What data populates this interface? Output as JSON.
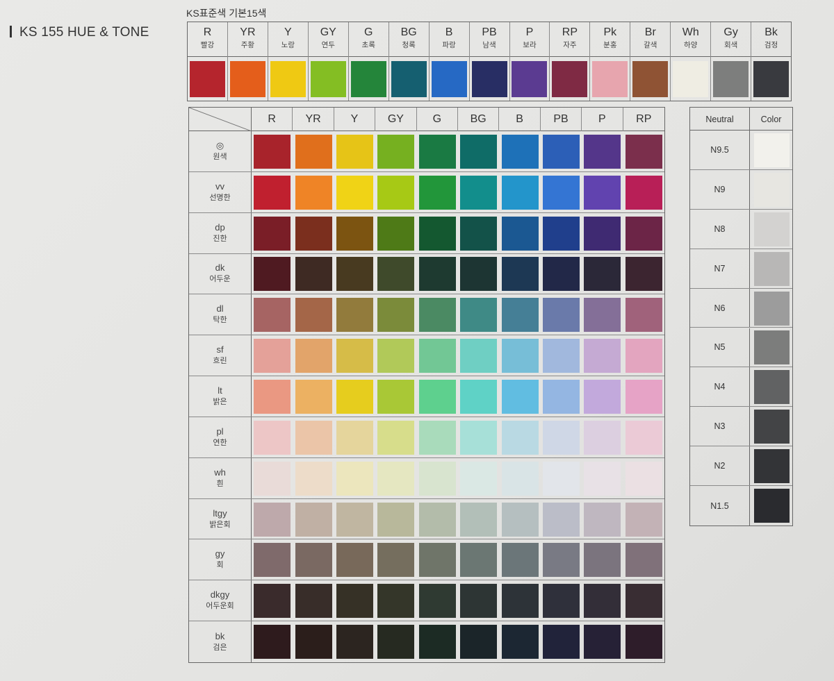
{
  "title": "KS 155 HUE & TONE",
  "basic_label": "KS표준색 기본15색",
  "basic": [
    {
      "code": "R",
      "name": "빨강",
      "color": "#b5252d"
    },
    {
      "code": "YR",
      "name": "주황",
      "color": "#e45e1b"
    },
    {
      "code": "Y",
      "name": "노랑",
      "color": "#efc913"
    },
    {
      "code": "GY",
      "name": "연두",
      "color": "#84be23"
    },
    {
      "code": "G",
      "name": "초록",
      "color": "#24853a"
    },
    {
      "code": "BG",
      "name": "청록",
      "color": "#155f70"
    },
    {
      "code": "B",
      "name": "파랑",
      "color": "#2669c4"
    },
    {
      "code": "PB",
      "name": "남색",
      "color": "#282e64"
    },
    {
      "code": "P",
      "name": "보라",
      "color": "#5b3b91"
    },
    {
      "code": "RP",
      "name": "자주",
      "color": "#7f2a44"
    },
    {
      "code": "Pk",
      "name": "분홍",
      "color": "#e7a5ae"
    },
    {
      "code": "Br",
      "name": "갈색",
      "color": "#8f5334"
    },
    {
      "code": "Wh",
      "name": "하양",
      "color": "#efede3"
    },
    {
      "code": "Gy",
      "name": "회색",
      "color": "#7d7e7d"
    },
    {
      "code": "Bk",
      "name": "검정",
      "color": "#393a3f"
    }
  ],
  "hues": [
    "R",
    "YR",
    "Y",
    "GY",
    "G",
    "BG",
    "B",
    "PB",
    "P",
    "RP"
  ],
  "tones": [
    {
      "code": "◎",
      "name": "원색",
      "colors": [
        "#a8232b",
        "#e06f1c",
        "#e6c417",
        "#76b020",
        "#1a7a43",
        "#0f6c67",
        "#1e71b8",
        "#2c5fb7",
        "#54368a",
        "#7b2f4c"
      ]
    },
    {
      "code": "vv",
      "name": "선명한",
      "colors": [
        "#c0202f",
        "#ef8426",
        "#f0d316",
        "#a7c915",
        "#22963a",
        "#128e8c",
        "#2395cb",
        "#3475d3",
        "#6143af",
        "#b81f57"
      ]
    },
    {
      "code": "dp",
      "name": "진한",
      "colors": [
        "#7a1e27",
        "#7b2f1e",
        "#7c5411",
        "#4e7a17",
        "#145830",
        "#135249",
        "#1b5892",
        "#203f8c",
        "#3f2a72",
        "#6c2547"
      ]
    },
    {
      "code": "dk",
      "name": "어두운",
      "colors": [
        "#4f1a21",
        "#3e2a23",
        "#483a20",
        "#3f4a2b",
        "#1e3a30",
        "#1d3533",
        "#1d3854",
        "#222848",
        "#2b2838",
        "#3c2530"
      ]
    },
    {
      "code": "dl",
      "name": "탁한",
      "colors": [
        "#a66463",
        "#a46648",
        "#927b3c",
        "#7b8b3a",
        "#4b8a63",
        "#3f8a86",
        "#457f96",
        "#6a7aaa",
        "#846f98",
        "#a0627b"
      ]
    },
    {
      "code": "sf",
      "name": "흐린",
      "colors": [
        "#e4a199",
        "#e2a46a",
        "#d6bc48",
        "#b1c959",
        "#72c795",
        "#6fcfc3",
        "#77bed7",
        "#a1b8dd",
        "#c5aad3",
        "#e3a5bf"
      ]
    },
    {
      "code": "lt",
      "name": "밝은",
      "colors": [
        "#ea9882",
        "#ecb162",
        "#e6cd1e",
        "#a9c836",
        "#5ed08e",
        "#5fd2c6",
        "#61bde1",
        "#94b6e2",
        "#c2a9dc",
        "#e6a3c6"
      ]
    },
    {
      "code": "pl",
      "name": "연한",
      "colors": [
        "#edc6c6",
        "#ebc5a8",
        "#e5d59c",
        "#d7dd8b",
        "#a9dbbb",
        "#a7e0d8",
        "#b9d9e3",
        "#cfd7e6",
        "#dccfe0",
        "#ebcad6"
      ]
    },
    {
      "code": "wh",
      "name": "흰",
      "colors": [
        "#e9dbd8",
        "#eddcc9",
        "#ece6bd",
        "#e5e7c1",
        "#d8e4cf",
        "#dae8e4",
        "#d9e4e6",
        "#e2e5ea",
        "#e8e1e6",
        "#ebe0e3"
      ]
    },
    {
      "code": "ltgy",
      "name": "밝은회",
      "colors": [
        "#bea9ab",
        "#c0b0a4",
        "#c0b6a1",
        "#b8b89b",
        "#b3bcaa",
        "#b2bfb8",
        "#b5bfc0",
        "#bbbdc8",
        "#bfb7c0",
        "#c3b2b6"
      ]
    },
    {
      "code": "gy",
      "name": "회",
      "colors": [
        "#7f6a6b",
        "#7a6962",
        "#78695a",
        "#756e5e",
        "#6f7569",
        "#6b7773",
        "#6b7679",
        "#797a84",
        "#7b747e",
        "#80717a"
      ]
    },
    {
      "code": "dkgy",
      "name": "어두운회",
      "colors": [
        "#3a2b2c",
        "#382d29",
        "#363126",
        "#343629",
        "#2f3a32",
        "#2d3534",
        "#2d3338",
        "#2f303b",
        "#332e38",
        "#392d33"
      ]
    },
    {
      "code": "bk",
      "name": "검은",
      "colors": [
        "#2e1b1d",
        "#2b1e1b",
        "#2c2520",
        "#262a21",
        "#1c2b24",
        "#1b2529",
        "#1c2733",
        "#21233a",
        "#262136",
        "#2e1d2a"
      ]
    }
  ],
  "neutral": {
    "header_neutral": "Neutral",
    "header_color": "Color",
    "rows": [
      {
        "label": "N9.5",
        "color": "#f2f1ec"
      },
      {
        "label": "N9",
        "color": "#e7e6e1"
      },
      {
        "label": "N8",
        "color": "#d3d2d0"
      },
      {
        "label": "N7",
        "color": "#b8b7b6"
      },
      {
        "label": "N6",
        "color": "#9c9c9c"
      },
      {
        "label": "N5",
        "color": "#7c7d7c"
      },
      {
        "label": "N4",
        "color": "#616263"
      },
      {
        "label": "N3",
        "color": "#434446"
      },
      {
        "label": "N2",
        "color": "#333437"
      },
      {
        "label": "N1.5",
        "color": "#2a2b2f"
      }
    ]
  }
}
